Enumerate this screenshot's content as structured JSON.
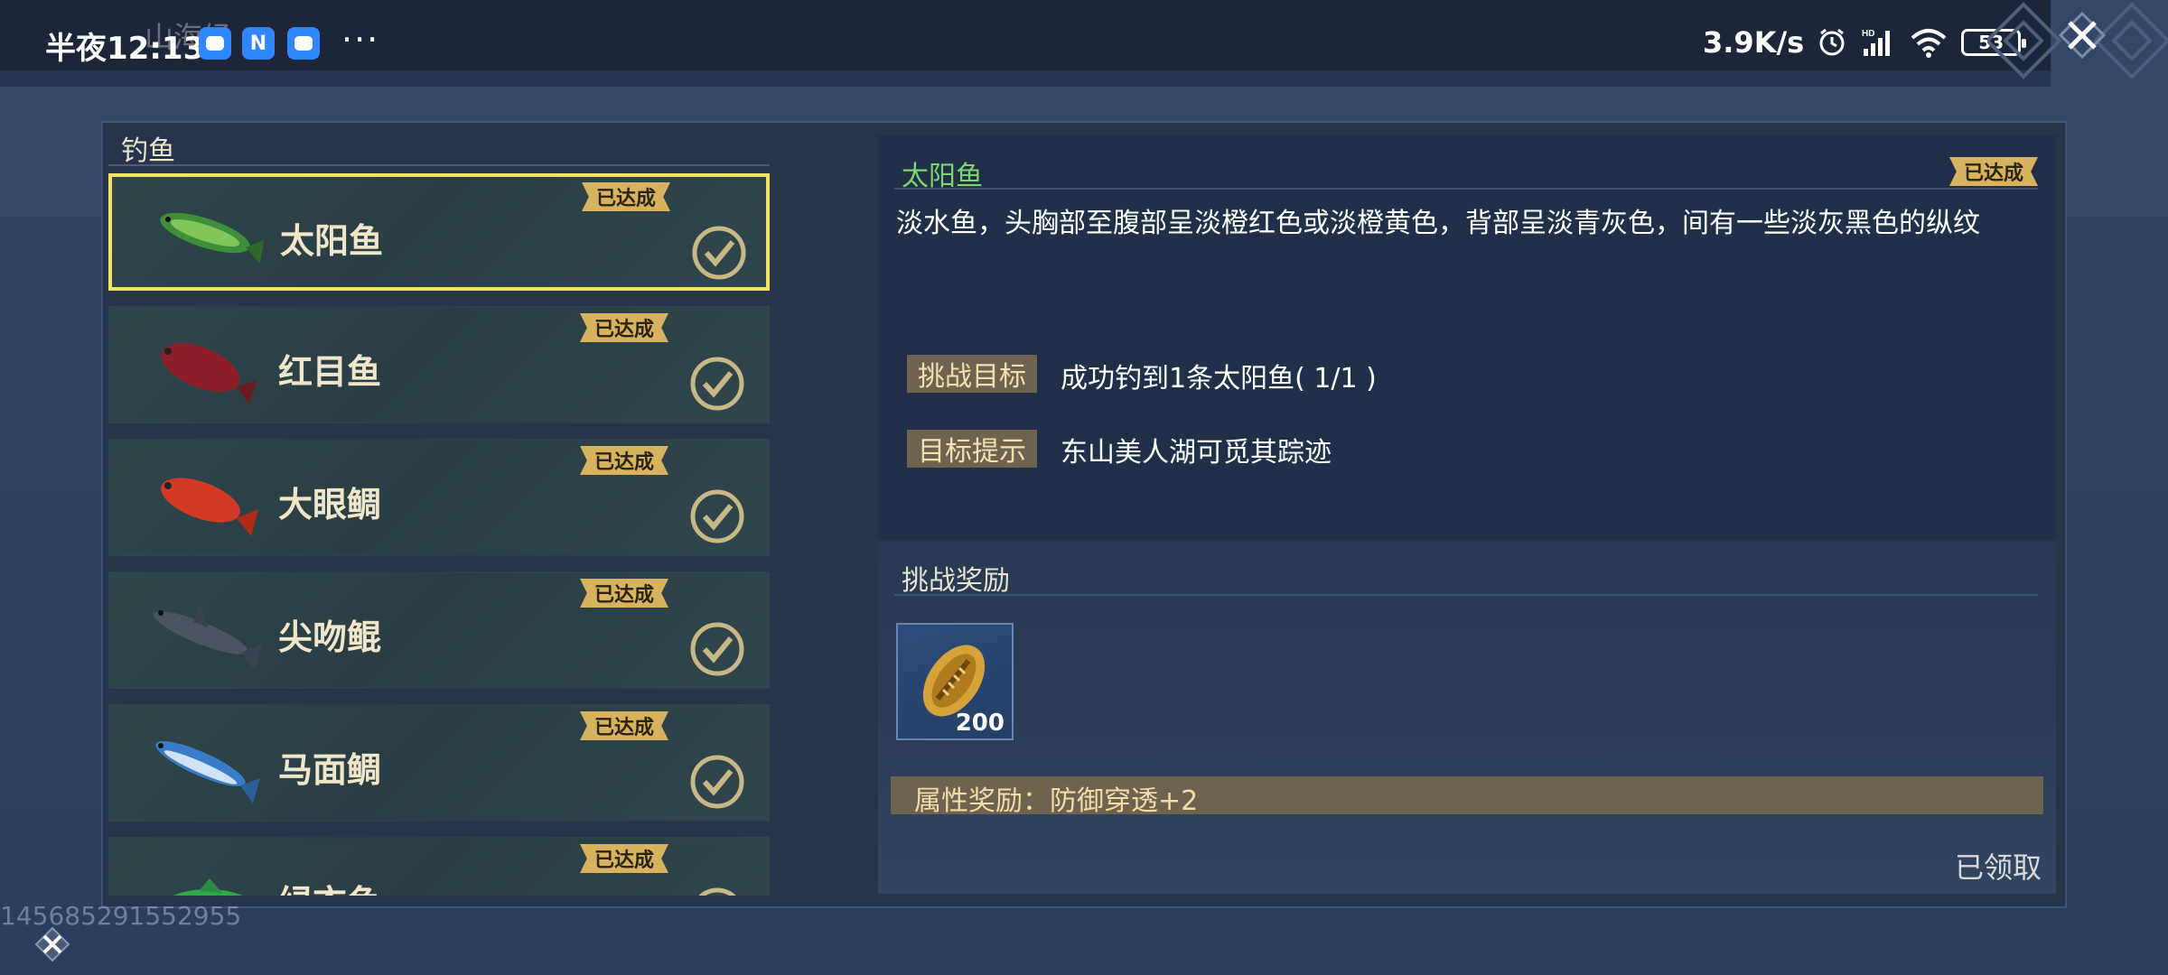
{
  "status_bar": {
    "time": "半夜12:13",
    "ghost_title": "山海经",
    "net_speed": "3.9K/s",
    "battery": "53",
    "more": "···"
  },
  "left": {
    "title": "钓鱼",
    "fish": [
      {
        "name": "太阳鱼",
        "badge": "已达成",
        "selected": true
      },
      {
        "name": "红目鱼",
        "badge": "已达成"
      },
      {
        "name": "大眼鲷",
        "badge": "已达成"
      },
      {
        "name": "尖吻鲲",
        "badge": "已达成"
      },
      {
        "name": "马面鲷",
        "badge": "已达成"
      },
      {
        "name": "绿衣鱼",
        "badge": "已达成"
      }
    ]
  },
  "detail": {
    "name": "太阳鱼",
    "badge": "已达成",
    "description": "淡水鱼，头胸部至腹部呈淡橙红色或淡橙黄色，背部呈淡青灰色，间有一些淡灰黑色的纵纹",
    "goal_label": "挑战目标",
    "goal_text": "成功钓到1条太阳鱼( 1/1 )",
    "hint_label": "目标提示",
    "hint_text": "东山美人湖可觅其踪迹"
  },
  "reward": {
    "title": "挑战奖励",
    "item_qty": "200",
    "attribute": "属性奖励：防御穿透+2",
    "claimed": "已领取"
  },
  "footer": {
    "uid": "145685291552955"
  },
  "colors": {
    "selected_border": "#f1e36a",
    "badge": "#d8b35f",
    "fish_name_green": "#7ed46e"
  }
}
